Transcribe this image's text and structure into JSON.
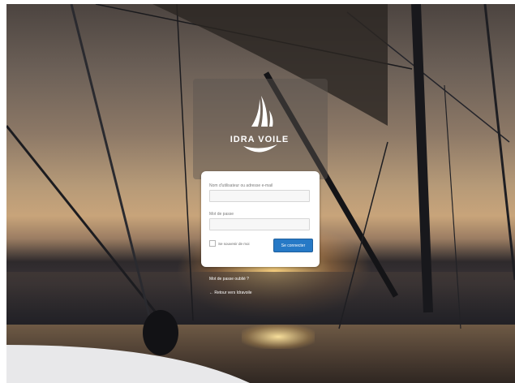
{
  "brand": {
    "name": "IDRA VOILE"
  },
  "login_form": {
    "username_label": "Nom d'utilisateur ou adresse e-mail",
    "username_value": "",
    "password_label": "Mot de passe",
    "password_value": "",
    "remember_label": "Se souvenir de moi",
    "submit_label": "Se connecter"
  },
  "links": {
    "lost_password": "Mot de passe oublié ?",
    "back_to_site": "← Retour vers Idravoile"
  }
}
